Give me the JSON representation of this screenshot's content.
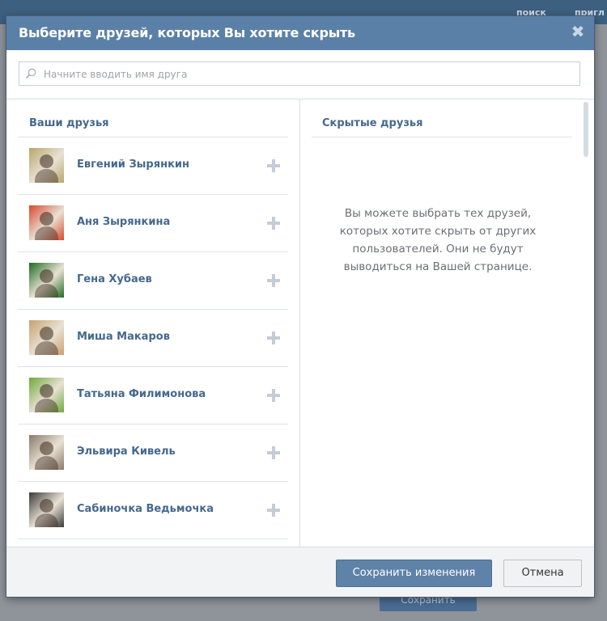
{
  "background": {
    "nav": [
      "поиск",
      "пригл"
    ],
    "save_label": "Сохранить"
  },
  "modal": {
    "title": "Выберите друзей, которых Вы хотите скрыть",
    "search": {
      "placeholder": "Начните вводить имя друга",
      "value": ""
    },
    "left": {
      "heading": "Ваши друзья",
      "friends": [
        {
          "name": "Евгений Зырянкин",
          "avatar_color": "#b8a66a"
        },
        {
          "name": "Аня Зырянкина",
          "avatar_color": "#d8482e"
        },
        {
          "name": "Гена Хубаев",
          "avatar_color": "#1f6b22"
        },
        {
          "name": "Миша Макаров",
          "avatar_color": "#c9a06e"
        },
        {
          "name": "Татьяна Филимонова",
          "avatar_color": "#6fa83a"
        },
        {
          "name": "Эльвира Кивель",
          "avatar_color": "#8a7a68"
        },
        {
          "name": "Сабиночка Ведьмочка",
          "avatar_color": "#3a3a3a"
        }
      ]
    },
    "right": {
      "heading": "Скрытые друзья",
      "empty_text": "Вы можете выбрать тех друзей, которых хотите скрыть от других пользователей. Они не будут выводиться на Вашей странице."
    },
    "footer": {
      "save_label": "Сохранить изменения",
      "cancel_label": "Отмена"
    }
  },
  "colors": {
    "header": "#5b80a8",
    "link": "#45688e",
    "button": "#5e82a8"
  },
  "icons": {
    "close": "close-icon",
    "search": "search-icon",
    "add": "plus-icon"
  }
}
